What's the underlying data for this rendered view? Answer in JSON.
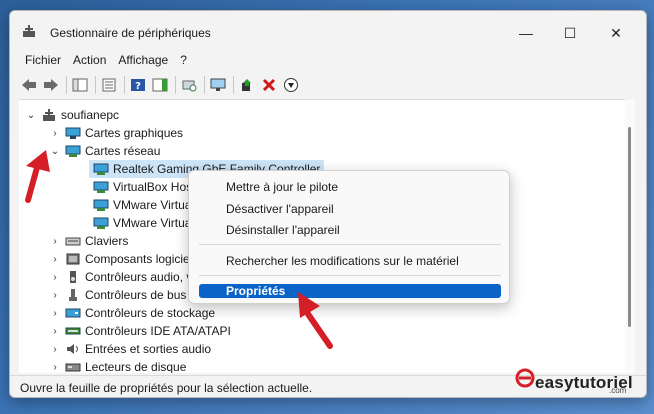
{
  "window": {
    "title": "Gestionnaire de périphériques"
  },
  "window_controls": {
    "minimize": "—",
    "maximize": "☐",
    "close": "✕"
  },
  "menu": [
    "Fichier",
    "Action",
    "Affichage",
    "?"
  ],
  "tree": {
    "root": "soufianepc",
    "items": [
      {
        "label": "Cartes graphiques",
        "icon": "display-adapter-icon",
        "expanded": false
      },
      {
        "label": "Cartes réseau",
        "icon": "network-adapter-icon",
        "expanded": true
      },
      {
        "label": "Realtek Gaming GbE Family Controller",
        "icon": "network-adapter-icon",
        "child": true,
        "selected": true
      },
      {
        "label": "VirtualBox Host-",
        "icon": "network-adapter-icon",
        "child": true
      },
      {
        "label": "VMware Virtual E",
        "icon": "network-adapter-icon",
        "child": true
      },
      {
        "label": "VMware Virtual E",
        "icon": "network-adapter-icon",
        "child": true
      },
      {
        "label": "Claviers",
        "icon": "keyboard-icon",
        "expanded": false
      },
      {
        "label": "Composants logicie",
        "icon": "software-component-icon",
        "expanded": false
      },
      {
        "label": "Contrôleurs audio, v",
        "icon": "audio-icon",
        "expanded": false
      },
      {
        "label": "Contrôleurs de bus U",
        "icon": "usb-icon",
        "expanded": false
      },
      {
        "label": "Contrôleurs de stockage",
        "icon": "storage-icon",
        "expanded": false
      },
      {
        "label": "Contrôleurs IDE ATA/ATAPI",
        "icon": "ide-icon",
        "expanded": false
      },
      {
        "label": "Entrées et sorties audio",
        "icon": "speaker-icon",
        "expanded": false
      },
      {
        "label": "Lecteurs de disque",
        "icon": "disk-icon",
        "expanded": false
      }
    ]
  },
  "context_menu": {
    "items": [
      "Mettre à jour le pilote",
      "Désactiver l'appareil",
      "Désinstaller l'appareil",
      "Rechercher les modifications sur le matériel",
      "Propriétés"
    ],
    "highlighted": "Propriétés"
  },
  "statusbar": {
    "text": "Ouvre la feuille de propriétés pour la sélection actuelle."
  },
  "watermark": {
    "text": "easytutoriel",
    "sub": ".com"
  },
  "colors": {
    "selection": "#cce4f7",
    "menu_highlight": "#0a64c8",
    "arrow": "#d41f26"
  }
}
